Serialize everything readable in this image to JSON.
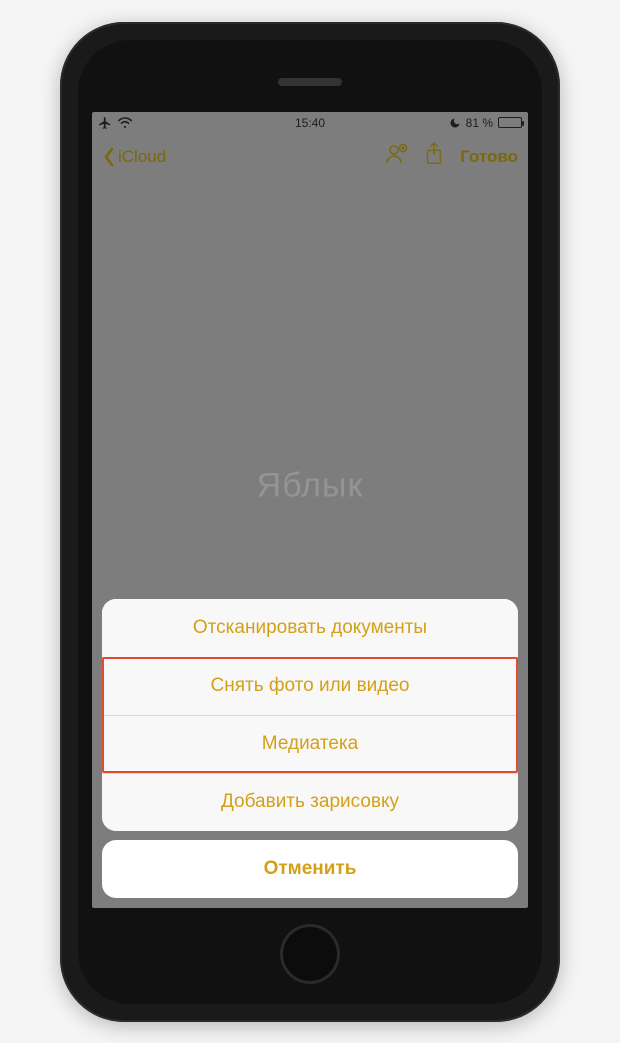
{
  "status": {
    "time": "15:40",
    "battery_text": "81 %",
    "battery_level": 81
  },
  "nav": {
    "back_label": "iCloud",
    "done_label": "Готово"
  },
  "watermark": "Яблык",
  "sheet": {
    "items": [
      "Отсканировать документы",
      "Снять фото или видео",
      "Медиатека",
      "Добавить зарисовку"
    ],
    "cancel": "Отменить"
  },
  "accent_color": "#d4a017",
  "highlight_color": "#e34b2e"
}
